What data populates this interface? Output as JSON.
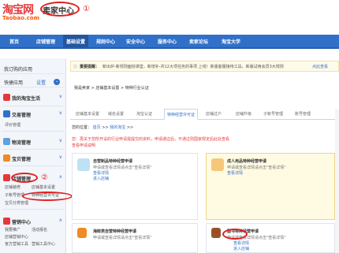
{
  "header": {
    "logo_cn": "淘宝网",
    "logo_en": "Taobao.com",
    "seller_center": "卖家中心",
    "m1": "①",
    "m2": "②",
    "m3": "③",
    "m4": "④"
  },
  "topnav": [
    "首页",
    "店铺管理",
    "基础设置",
    "规则中心",
    "安全中心",
    "服务中心",
    "卖家论坛",
    "淘宝大学"
  ],
  "sidebar": {
    "apps": "我订购的应用",
    "quick": "快捷应用",
    "quick_btn": "设置",
    "groups": {
      "life": "我的淘宝生活",
      "trade": "交易管理",
      "trade_sub": "评价管理",
      "logistics": "物流管理",
      "goods": "宝贝管理",
      "shop": "店铺管理",
      "shop_sub1": "店铺装修",
      "shop_sub2": "店铺基本设置",
      "shop_sub3": "子帐号管理",
      "shop_sub4": "特种经营许可证",
      "shop_sub5": "宝贝分类管理",
      "marketing": "营销中心",
      "mk1": "我要推广",
      "mk2": "活动报名",
      "mk3": "店铺营销中心",
      "mk4": "官方营销工具",
      "mk5": "营销工具中心"
    }
  },
  "notice": {
    "label": "重要提醒：",
    "text": "新出炉-新规则面授课堂，新增补-共12大项任务的事项 上线！新版客服接待工具，新版试用会员3大规则",
    "link": "点此查看"
  },
  "breadcrumb": "我是卖家 > 店铺基本设置 > 特种行业认证",
  "tabs": [
    "店铺基本设置",
    "域名设置",
    "淘宝认证",
    "特种经营许可证",
    "店铺过户",
    "店铺升级",
    "子帐号管理",
    "账号管理"
  ],
  "position": {
    "label": "您的位置：",
    "home": "首页",
    "sep1": ">>",
    "mid": "我的淘宝",
    "sep2": ">>"
  },
  "warnings": {
    "line1": "您：再关于您所开设的行业申请需提交的资料，申请通过后，不通过则国家规定后此处查看",
    "line2": "查看申请说明"
  },
  "cards": [
    {
      "title": "自营制品特种经营申请",
      "desc1": "申请或查看详情请点击\"查看详情\"",
      "link1": "查看详情",
      "link2": "进入店铺"
    },
    {
      "title": "成人用品特种经营申请",
      "desc1": "申请或查看详情请点击\"查看详情\"",
      "link1": "查看详情",
      "link2": ""
    },
    {
      "title": "海鲜类自营特种经营申请",
      "desc1": "申请或查看详情请点击\"查看详情\"",
      "link1": "",
      "link2": ""
    },
    {
      "title": "图书特种经营申请",
      "desc1": "申请或查看详情请点击\"查看详情\"",
      "link1": "查看详情",
      "link2": "进入店铺"
    }
  ]
}
